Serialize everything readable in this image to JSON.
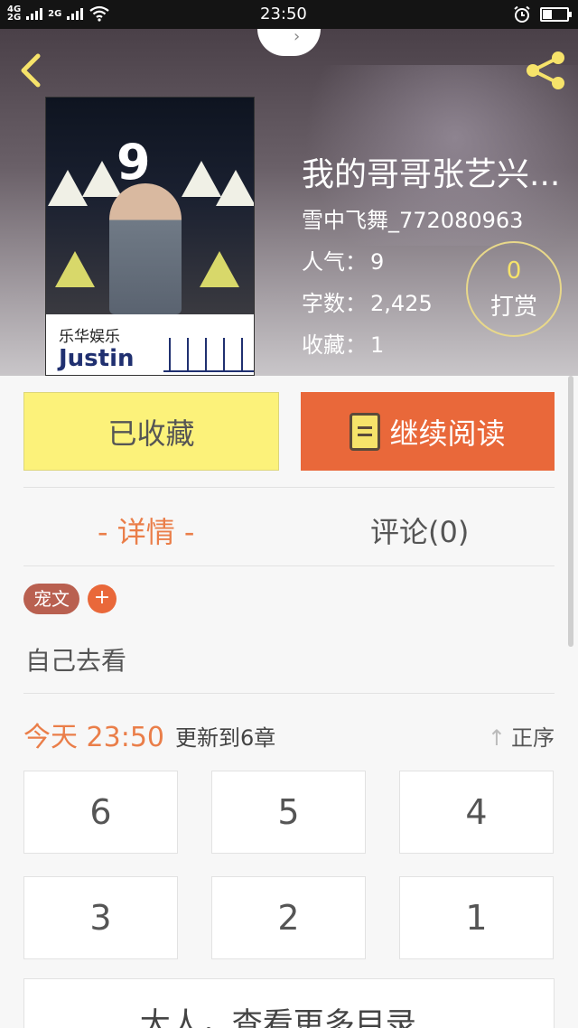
{
  "status_bar": {
    "net1": "4G",
    "net2": "2G",
    "net3": "2G",
    "time": "23:50"
  },
  "header": {
    "back_icon": "chevron-left-icon",
    "share_icon": "share-icon",
    "accent": "#f6e36a"
  },
  "book": {
    "cover_brand": "乐华娱乐",
    "cover_name": "Justin",
    "title": "我的哥哥张艺兴...",
    "author": "雪中飞舞_772080963",
    "stats": [
      {
        "label": "人气：",
        "value": "9"
      },
      {
        "label": "字数：",
        "value": "2,425"
      },
      {
        "label": "收藏：",
        "value": "1"
      }
    ],
    "tip": {
      "count": "0",
      "label": "打赏"
    }
  },
  "actions": {
    "favorite_label": "已收藏",
    "read_label": "继续阅读",
    "favorite_color": "#fcf27a",
    "read_color": "#e9683a"
  },
  "tabs": {
    "detail": "- 详情 -",
    "comments": "评论(0)"
  },
  "tags": {
    "items": [
      "宠文"
    ],
    "add_label": "+"
  },
  "description": "自己去看",
  "update": {
    "time": "今天 23:50",
    "text": "更新到6章",
    "sort_label": "正序"
  },
  "chapters": [
    "6",
    "5",
    "4",
    "3",
    "2",
    "1"
  ],
  "more_label": "大人，查看更多目录"
}
